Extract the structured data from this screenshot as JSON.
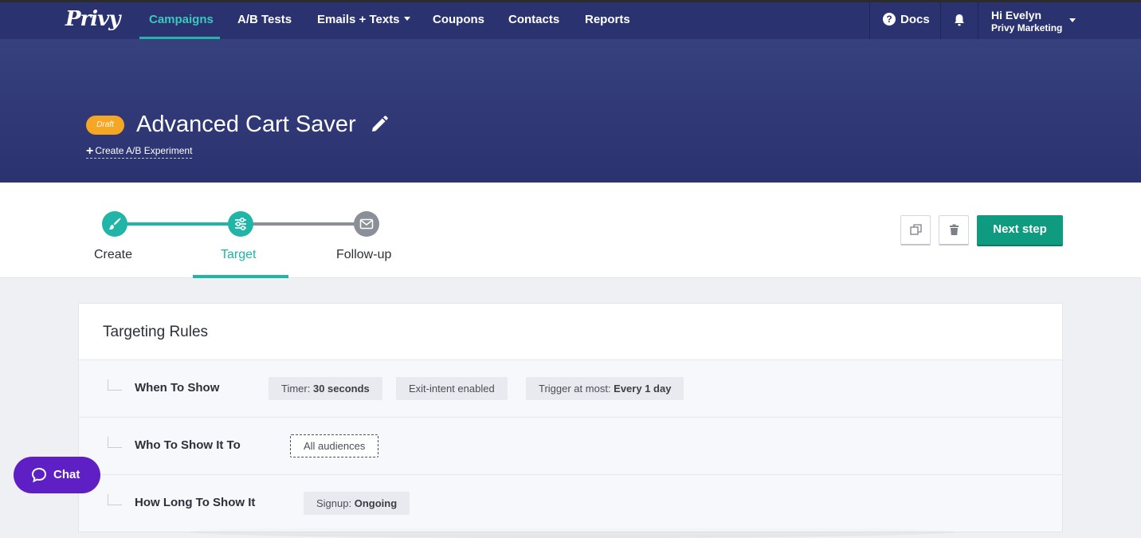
{
  "brand": {
    "logo_text": "Privy",
    "accent": "#20b5a6",
    "nav_bg": "#2b3270"
  },
  "nav": {
    "items": [
      {
        "label": "Campaigns",
        "active": true
      },
      {
        "label": "A/B Tests"
      },
      {
        "label": "Emails + Texts",
        "has_dropdown": true
      },
      {
        "label": "Coupons"
      },
      {
        "label": "Contacts"
      },
      {
        "label": "Reports"
      }
    ],
    "docs_label": "Docs",
    "user_greeting": "Hi Evelyn",
    "user_org": "Privy Marketing"
  },
  "campaign": {
    "status_badge": "Draft",
    "status_color": "#f5a623",
    "title": "Advanced Cart Saver",
    "create_ab_label": "Create A/B Experiment"
  },
  "steps": {
    "items": [
      {
        "label": "Create",
        "icon": "brush-icon",
        "state": "done"
      },
      {
        "label": "Target",
        "icon": "sliders-icon",
        "state": "active"
      },
      {
        "label": "Follow-up",
        "icon": "envelope-icon",
        "state": "pending"
      }
    ],
    "next_label": "Next step"
  },
  "targeting": {
    "title": "Targeting Rules",
    "rules": [
      {
        "label": "When To Show",
        "chips": [
          {
            "prefix": "Timer: ",
            "value": "30 seconds"
          },
          {
            "prefix": "Exit-intent enabled",
            "value": ""
          },
          {
            "prefix": "Trigger at most: ",
            "value": "Every 1 day"
          }
        ]
      },
      {
        "label": "Who To Show It To",
        "chips": [
          {
            "prefix": "All audiences",
            "value": "",
            "dashed": true
          }
        ]
      },
      {
        "label": "How Long To Show It",
        "chips": [
          {
            "prefix": "Signup: ",
            "value": "Ongoing"
          }
        ]
      }
    ]
  },
  "chat": {
    "label": "Chat",
    "color": "#5e1fc4"
  }
}
